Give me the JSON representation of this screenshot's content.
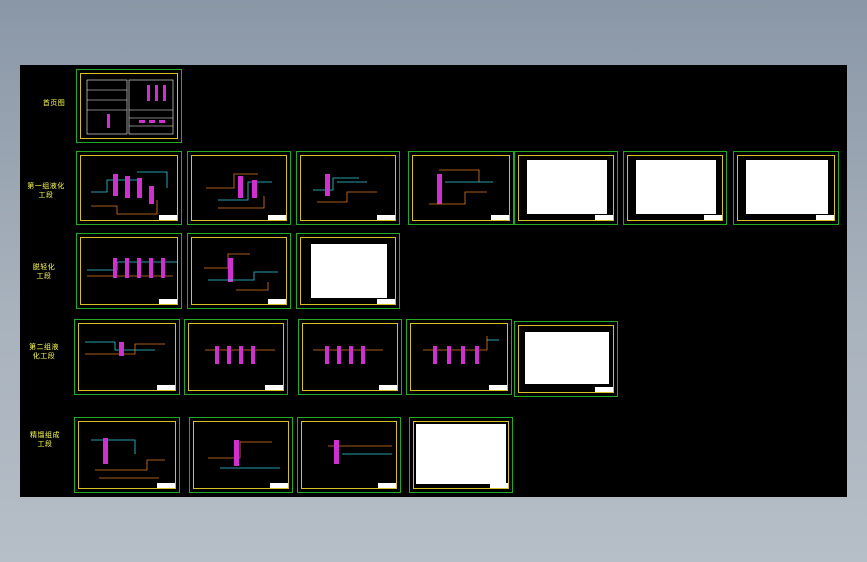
{
  "rows": [
    {
      "label": "首页图",
      "sheets": 1
    },
    {
      "label": "第一组液化工段",
      "sheets": 7
    },
    {
      "label": "脱轻化工段",
      "sheets": 3
    },
    {
      "label": "第二组液化工段",
      "sheets": 5
    },
    {
      "label": "精馏组成工段",
      "sheets": 4
    }
  ],
  "colors": {
    "background": "#000000",
    "sheet_border": "#22aa22",
    "title_frame": "#d8c020",
    "pipe_orange": "#e07a20",
    "pipe_cyan": "#30d0e0",
    "equipment_magenta": "#d030d0",
    "label_yellow": "#ffff55"
  },
  "icons": [
    "drawing-sheet-thumbnail",
    "title-block",
    "data-table-sheet"
  ]
}
